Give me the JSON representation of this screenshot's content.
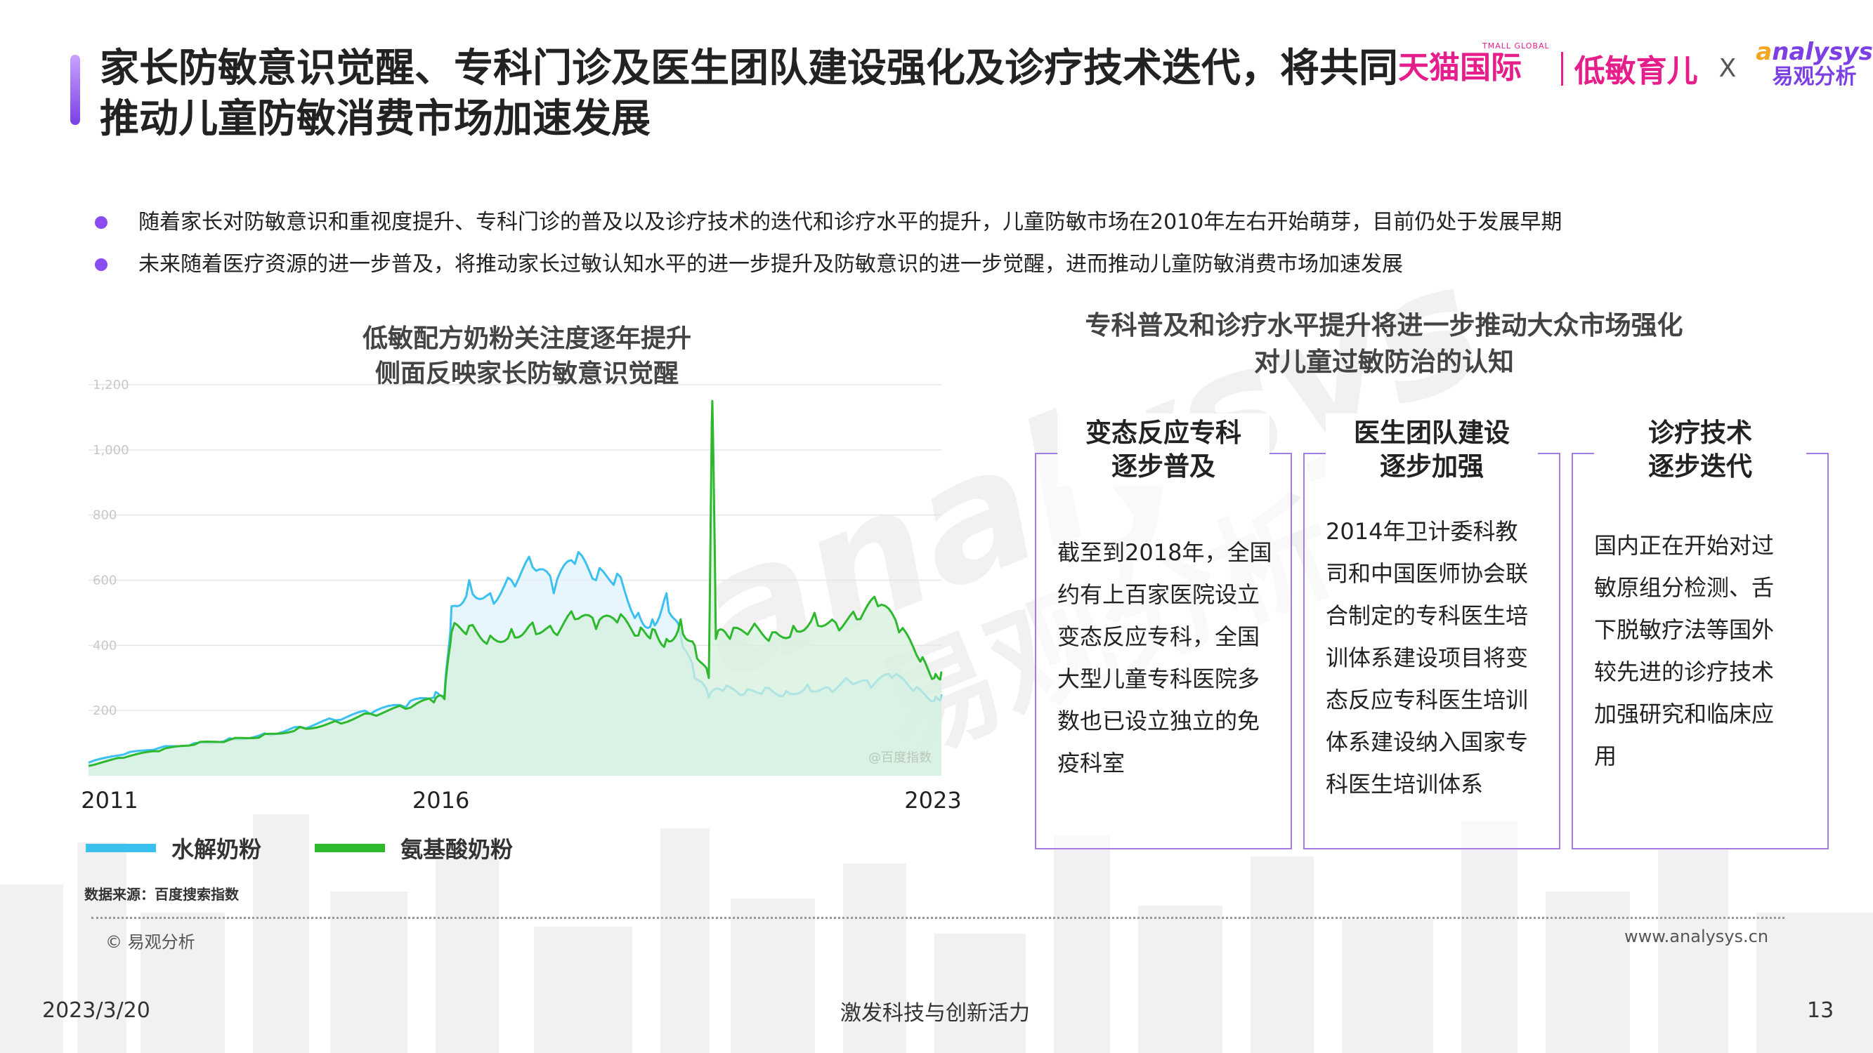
{
  "title": "家长防敏意识觉醒、专科门诊及医生团队建设强化及诊疗技术迭代，将共同推动儿童防敏消费市场加速发展",
  "logo": {
    "tmall_sub": "TMALL GLOBAL",
    "tmall": "天猫国际",
    "low_sens": "低敏育儿",
    "x": "X",
    "analysys_a": "a",
    "analysys_rest": "nalysys",
    "analysys_cn": "易观分析"
  },
  "bullets": [
    "随着家长对防敏意识和重视度提升、专科门诊的普及以及诊疗技术的迭代和诊疗水平的提升，儿童防敏市场在2010年左右开始萌芽，目前仍处于发展早期",
    "未来随着医疗资源的进一步普及，将推动家长过敏认知水平的进一步提升及防敏意识的进一步觉醒，进而推动儿童防敏消费市场加速发展"
  ],
  "watermark": {
    "en": "analysys",
    "cn": "易观分析"
  },
  "chart_data": {
    "type": "area",
    "title": "低敏配方奶粉关注度逐年提升\n侧面反映家长防敏意识觉醒",
    "title_lines": [
      "低敏配方奶粉关注度逐年提升",
      "侧面反映家长防敏意识觉醒"
    ],
    "x_ticks": [
      "2011",
      "2016",
      "2023"
    ],
    "y_ticks": [
      "200",
      "400",
      "600",
      "800",
      "1,000",
      "1,200"
    ],
    "ylim": [
      0,
      1200
    ],
    "xlim": [
      2011,
      2023.1
    ],
    "grid": true,
    "legend": "bottom-left",
    "inner_label": "@百度指数",
    "series": [
      {
        "name": "水解奶粉",
        "color": "#3cc0f0",
        "fill": "#dff3fb",
        "points": [
          [
            2011.0,
            40
          ],
          [
            2011.5,
            65
          ],
          [
            2012.0,
            85
          ],
          [
            2012.5,
            100
          ],
          [
            2013.0,
            115
          ],
          [
            2013.5,
            130
          ],
          [
            2014.0,
            150
          ],
          [
            2014.5,
            170
          ],
          [
            2015.0,
            190
          ],
          [
            2015.5,
            210
          ],
          [
            2015.9,
            240
          ],
          [
            2016.05,
            250
          ],
          [
            2016.15,
            520
          ],
          [
            2016.4,
            600
          ],
          [
            2016.7,
            560
          ],
          [
            2017.0,
            600
          ],
          [
            2017.3,
            640
          ],
          [
            2017.6,
            560
          ],
          [
            2017.9,
            650
          ],
          [
            2018.2,
            600
          ],
          [
            2018.5,
            620
          ],
          [
            2018.8,
            500
          ],
          [
            2019.0,
            480
          ],
          [
            2019.2,
            560
          ],
          [
            2019.4,
            430
          ],
          [
            2019.6,
            300
          ],
          [
            2019.8,
            240
          ],
          [
            2020.0,
            260
          ],
          [
            2020.3,
            250
          ],
          [
            2020.6,
            270
          ],
          [
            2020.9,
            260
          ],
          [
            2021.2,
            280
          ],
          [
            2021.5,
            270
          ],
          [
            2021.8,
            290
          ],
          [
            2022.1,
            270
          ],
          [
            2022.4,
            300
          ],
          [
            2022.7,
            260
          ],
          [
            2023.0,
            230
          ],
          [
            2023.1,
            250
          ]
        ]
      },
      {
        "name": "氨基酸奶粉",
        "color": "#2db82d",
        "fill": "#d6f0dd",
        "points": [
          [
            2011.0,
            30
          ],
          [
            2011.5,
            55
          ],
          [
            2012.0,
            75
          ],
          [
            2012.5,
            95
          ],
          [
            2013.0,
            110
          ],
          [
            2013.5,
            128
          ],
          [
            2014.0,
            150
          ],
          [
            2014.5,
            168
          ],
          [
            2015.0,
            190
          ],
          [
            2015.5,
            205
          ],
          [
            2015.9,
            225
          ],
          [
            2016.05,
            235
          ],
          [
            2016.15,
            440
          ],
          [
            2016.4,
            460
          ],
          [
            2016.7,
            430
          ],
          [
            2017.0,
            450
          ],
          [
            2017.3,
            470
          ],
          [
            2017.6,
            440
          ],
          [
            2017.9,
            480
          ],
          [
            2018.2,
            450
          ],
          [
            2018.5,
            470
          ],
          [
            2018.8,
            430
          ],
          [
            2019.0,
            450
          ],
          [
            2019.2,
            420
          ],
          [
            2019.4,
            480
          ],
          [
            2019.6,
            400
          ],
          [
            2019.8,
            300
          ],
          [
            2019.85,
            1150
          ],
          [
            2019.9,
            420
          ],
          [
            2020.1,
            420
          ],
          [
            2020.4,
            450
          ],
          [
            2020.7,
            440
          ],
          [
            2021.0,
            460
          ],
          [
            2021.3,
            500
          ],
          [
            2021.6,
            470
          ],
          [
            2021.9,
            480
          ],
          [
            2022.2,
            520
          ],
          [
            2022.5,
            440
          ],
          [
            2022.8,
            350
          ],
          [
            2023.0,
            300
          ],
          [
            2023.1,
            320
          ]
        ]
      }
    ]
  },
  "source": "数据来源：百度搜索指数",
  "copyright": "© 易观分析",
  "website": "www.analysys.cn",
  "right": {
    "title_lines": [
      "专科普及和诊疗水平提升将进一步推动大众市场强化",
      "对儿童过敏防治的认知"
    ],
    "cards": [
      {
        "head": [
          "变态反应专科",
          "逐步普及"
        ],
        "lines": [
          "截至到2018年，全国",
          "约有上百家医院设立",
          "变态反应专科，全国",
          "大型儿童专科医院多",
          "数也已设立独立的免",
          "疫科室"
        ]
      },
      {
        "head": [
          "医生团队建设",
          "逐步加强"
        ],
        "lines": [
          "2014年卫计委科教",
          "司和中国医师协会联",
          "合制定的专科医生培",
          "训体系建设项目将变",
          "态反应专科医生培训",
          "体系建设纳入国家专",
          "科医生培训体系"
        ]
      },
      {
        "head": [
          "诊疗技术",
          "逐步迭代"
        ],
        "lines": [
          "国内正在开始对过",
          "敏原组分检测、舌",
          "下脱敏疗法等国外",
          "较先进的诊疗技术",
          "加强研究和临床应",
          "用"
        ]
      }
    ]
  },
  "footer": {
    "date": "2023/3/20",
    "slogan": "激发科技与创新活力",
    "page": "13"
  }
}
